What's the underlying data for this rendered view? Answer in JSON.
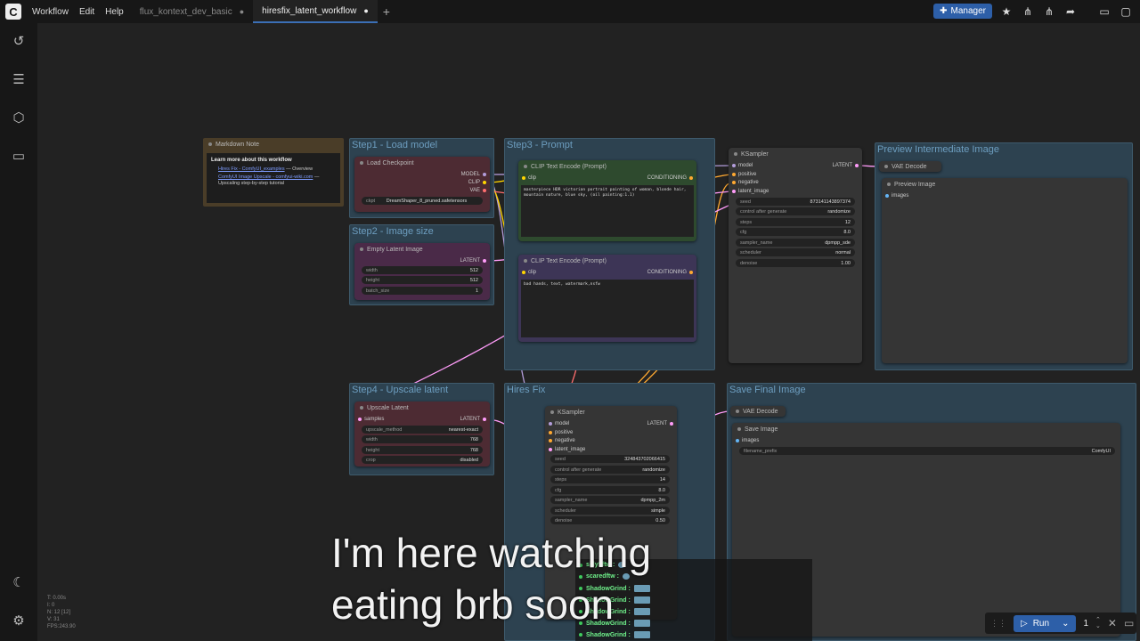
{
  "topbar": {
    "logo": "C",
    "menu": [
      "Workflow",
      "Edit",
      "Help"
    ],
    "tabs": [
      {
        "label": "flux_kontext_dev_basic",
        "active": false
      },
      {
        "label": "hiresfix_latent_workflow",
        "active": true
      }
    ],
    "manager_label": "Manager"
  },
  "groups": {
    "step1": "Step1 - Load model",
    "step2": "Step2 - Image size",
    "step3": "Step3 - Prompt",
    "preview": "Preview Intermediate Image",
    "step4": "Step4 - Upscale latent",
    "hires": "Hires Fix",
    "save": "Save Final Image"
  },
  "markdown_note": {
    "title": "Markdown Note",
    "heading": "Learn more about this workflow",
    "link1": "Hires Fix - ComfyUI_examples",
    "link1_suffix": " — Overview",
    "link2": "ComfyUI Image Upscale - comfyui-wiki.com",
    "link2_suffix": " —",
    "line3": "Upscaling step-by-step tutorial"
  },
  "load_checkpoint": {
    "title": "Load Checkpoint",
    "out_model": "MODEL",
    "out_clip": "CLIP",
    "out_vae": "VAE",
    "ckpt_label": "ckpt",
    "ckpt_value": "DreamShaper_8_pruned.safetensors"
  },
  "empty_latent": {
    "title": "Empty Latent Image",
    "out": "LATENT",
    "width_label": "width",
    "width": "512",
    "height_label": "height",
    "height": "512",
    "batch_label": "batch_size",
    "batch": "1"
  },
  "clip_pos": {
    "title": "CLIP Text Encode (Prompt)",
    "in": "clip",
    "out": "CONDITIONING",
    "text": "masterpiece HDR victorian portrait painting of woman, blonde hair, mountain nature, blue sky, (oil painting:1.1)"
  },
  "clip_neg": {
    "title": "CLIP Text Encode (Prompt)",
    "in": "clip",
    "out": "CONDITIONING",
    "text": "bad hands, text, watermark,nsfw"
  },
  "ksampler1": {
    "title": "KSampler",
    "inputs": [
      "model",
      "positive",
      "negative",
      "latent_image"
    ],
    "out": "LATENT",
    "widgets": [
      {
        "label": "seed",
        "value": "873141143897374"
      },
      {
        "label": "control after generate",
        "value": "randomize"
      },
      {
        "label": "steps",
        "value": "12"
      },
      {
        "label": "cfg",
        "value": "8.0"
      },
      {
        "label": "sampler_name",
        "value": "dpmpp_sde"
      },
      {
        "label": "scheduler",
        "value": "normal"
      },
      {
        "label": "denoise",
        "value": "1.00"
      }
    ]
  },
  "vae_decode1": {
    "title": "VAE Decode"
  },
  "preview_image": {
    "title": "Preview Image",
    "in": "images"
  },
  "upscale_latent": {
    "title": "Upscale Latent",
    "in": "samples",
    "out": "LATENT",
    "widgets": [
      {
        "label": "upscale_method",
        "value": "nearest-exact"
      },
      {
        "label": "width",
        "value": "768"
      },
      {
        "label": "height",
        "value": "768"
      },
      {
        "label": "crop",
        "value": "disabled"
      }
    ]
  },
  "ksampler2": {
    "title": "KSampler",
    "inputs": [
      "model",
      "positive",
      "negative",
      "latent_image"
    ],
    "out": "LATENT",
    "widgets": [
      {
        "label": "seed",
        "value": "324843702066415"
      },
      {
        "label": "control after generate",
        "value": "randomize"
      },
      {
        "label": "steps",
        "value": "14"
      },
      {
        "label": "cfg",
        "value": "8.0"
      },
      {
        "label": "sampler_name",
        "value": "dpmpp_2m"
      },
      {
        "label": "scheduler",
        "value": "simple"
      },
      {
        "label": "denoise",
        "value": "0.50"
      }
    ]
  },
  "vae_decode2": {
    "title": "VAE Decode"
  },
  "save_image": {
    "title": "Save Image",
    "in": "images",
    "prefix_label": "filename_prefix",
    "prefix_value": "ComfyUI"
  },
  "stats": [
    "T: 0.00s",
    "I: 0",
    "N: 12 [12]",
    "V: 31",
    "FPS:243.90"
  ],
  "subtitle": {
    "line1": "I'm here watching",
    "line2": "eating brb soon"
  },
  "chat": [
    {
      "name": "sillyfiftw :"
    },
    {
      "name": "scaredftw :"
    },
    {
      "name": "ShadowGrind :"
    },
    {
      "name": "ShadowGrind :"
    },
    {
      "name": "ShadowGrind :"
    },
    {
      "name": "ShadowGrind :"
    },
    {
      "name": "ShadowGrind :"
    }
  ],
  "run_bar": {
    "run_label": "Run",
    "batch_count": "1"
  },
  "colors": {
    "accent": "#2d5fa8",
    "model_link": "#b39ddb",
    "clip_link": "#ffd500",
    "vae_link": "#ff6e6e",
    "latent_link": "#ff9cf9",
    "conditioning_link": "#ffa931",
    "image_link": "#64b5f6"
  }
}
